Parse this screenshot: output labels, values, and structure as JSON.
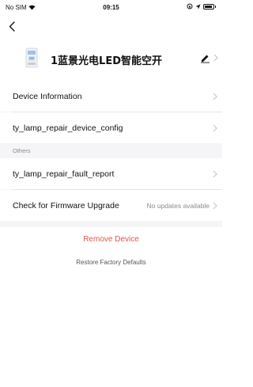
{
  "status_bar": {
    "carrier": "No SIM",
    "time": "09:15"
  },
  "device": {
    "name": "1蓝景光电LED智能空开"
  },
  "settings": {
    "device_information": "Device Information",
    "device_config": "ty_lamp_repair_device_config",
    "others_title": "Others",
    "fault_report": "ty_lamp_repair_fault_report",
    "firmware_upgrade": "Check for Firmware Upgrade",
    "firmware_status": "No updates available"
  },
  "actions": {
    "remove_device": "Remove Device",
    "restore_factory": "Restore Factory Defaults"
  },
  "colors": {
    "accent_red": "#e0564a",
    "muted_text": "#8a8a8e",
    "background": "#f5f5f7"
  }
}
